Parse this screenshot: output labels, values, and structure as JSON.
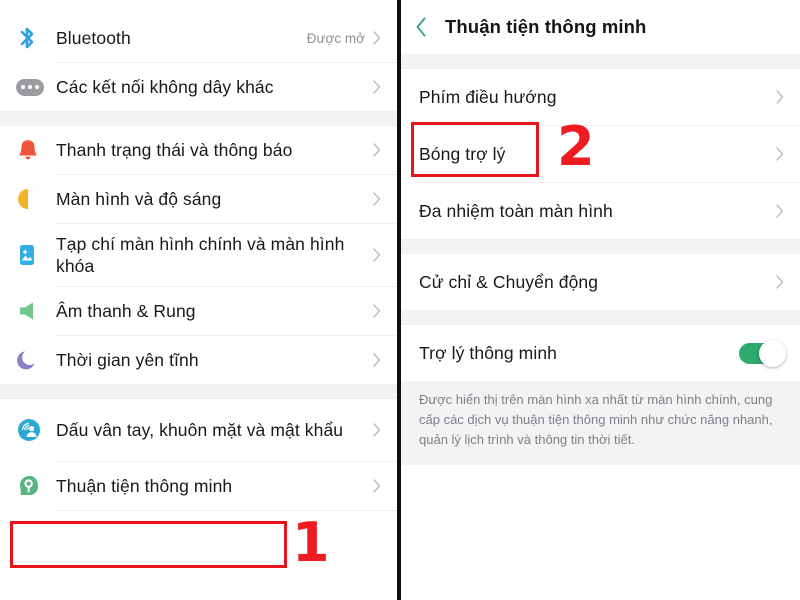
{
  "left_panel": {
    "name": "settings-list",
    "groups": [
      {
        "items": [
          {
            "icon": "bluetooth-icon",
            "label": "Bluetooth",
            "value": "Được mở",
            "chevron": "›"
          },
          {
            "icon": "wireless-connections-icon",
            "label": "Các kết nối không dây khác",
            "value": "",
            "chevron": "›"
          }
        ]
      },
      {
        "items": [
          {
            "icon": "bell-notification-icon",
            "label": "Thanh trạng thái và thông báo",
            "value": "",
            "chevron": "›"
          },
          {
            "icon": "brightness-icon",
            "label": "Màn hình và độ sáng",
            "value": "",
            "chevron": "›"
          },
          {
            "icon": "wallpaper-icon",
            "label": "Tạp chí màn hình chính và màn hình khóa",
            "value": "",
            "chevron": "›"
          },
          {
            "icon": "speaker-sound-icon",
            "label": "Âm thanh & Rung",
            "value": "",
            "chevron": "›"
          },
          {
            "icon": "moon-quiet-time-icon",
            "label": "Thời gian yên tĩnh",
            "value": "",
            "chevron": "›"
          }
        ]
      },
      {
        "items": [
          {
            "icon": "fingerprint-face-icon",
            "label": "Dấu vân tay, khuôn mặt và mật khẩu",
            "value": "",
            "chevron": "›"
          },
          {
            "icon": "smart-convenience-icon",
            "label": "Thuận tiện thông minh",
            "value": "",
            "chevron": "›"
          }
        ]
      }
    ]
  },
  "right_panel": {
    "header": {
      "back_icon": "back-chevron-icon",
      "title": "Thuận tiện thông minh"
    },
    "groups": [
      {
        "items": [
          {
            "label": "Phím điều hướng",
            "chevron": "›"
          },
          {
            "label": "Bóng trợ lý",
            "chevron": "›"
          },
          {
            "label": "Đa nhiệm toàn màn hình",
            "chevron": "›"
          }
        ]
      },
      {
        "items": [
          {
            "label": "Cử chỉ & Chuyển động",
            "chevron": "›"
          }
        ]
      },
      {
        "items": [
          {
            "label": "Trợ lý thông minh",
            "toggle": true,
            "toggle_on": true
          }
        ]
      }
    ],
    "description": "Được hiển thị trên màn hình xa nhất từ màn hình chính, cung cấp các dịch vụ thuận tiện thông minh như chức năng nhanh, quản lý lịch trình và thông tin thời tiết."
  },
  "annotations": [
    {
      "id": "1",
      "number": "1",
      "target": "smart-convenience-row"
    },
    {
      "id": "2",
      "number": "2",
      "target": "assistive-ball-row"
    }
  ],
  "colors": {
    "accent_green": "#2bab6e",
    "annotation_red": "#ee1c22",
    "section_background": "#f2f3f5",
    "primary_text": "#18191b",
    "secondary_text": "#8e9094"
  }
}
